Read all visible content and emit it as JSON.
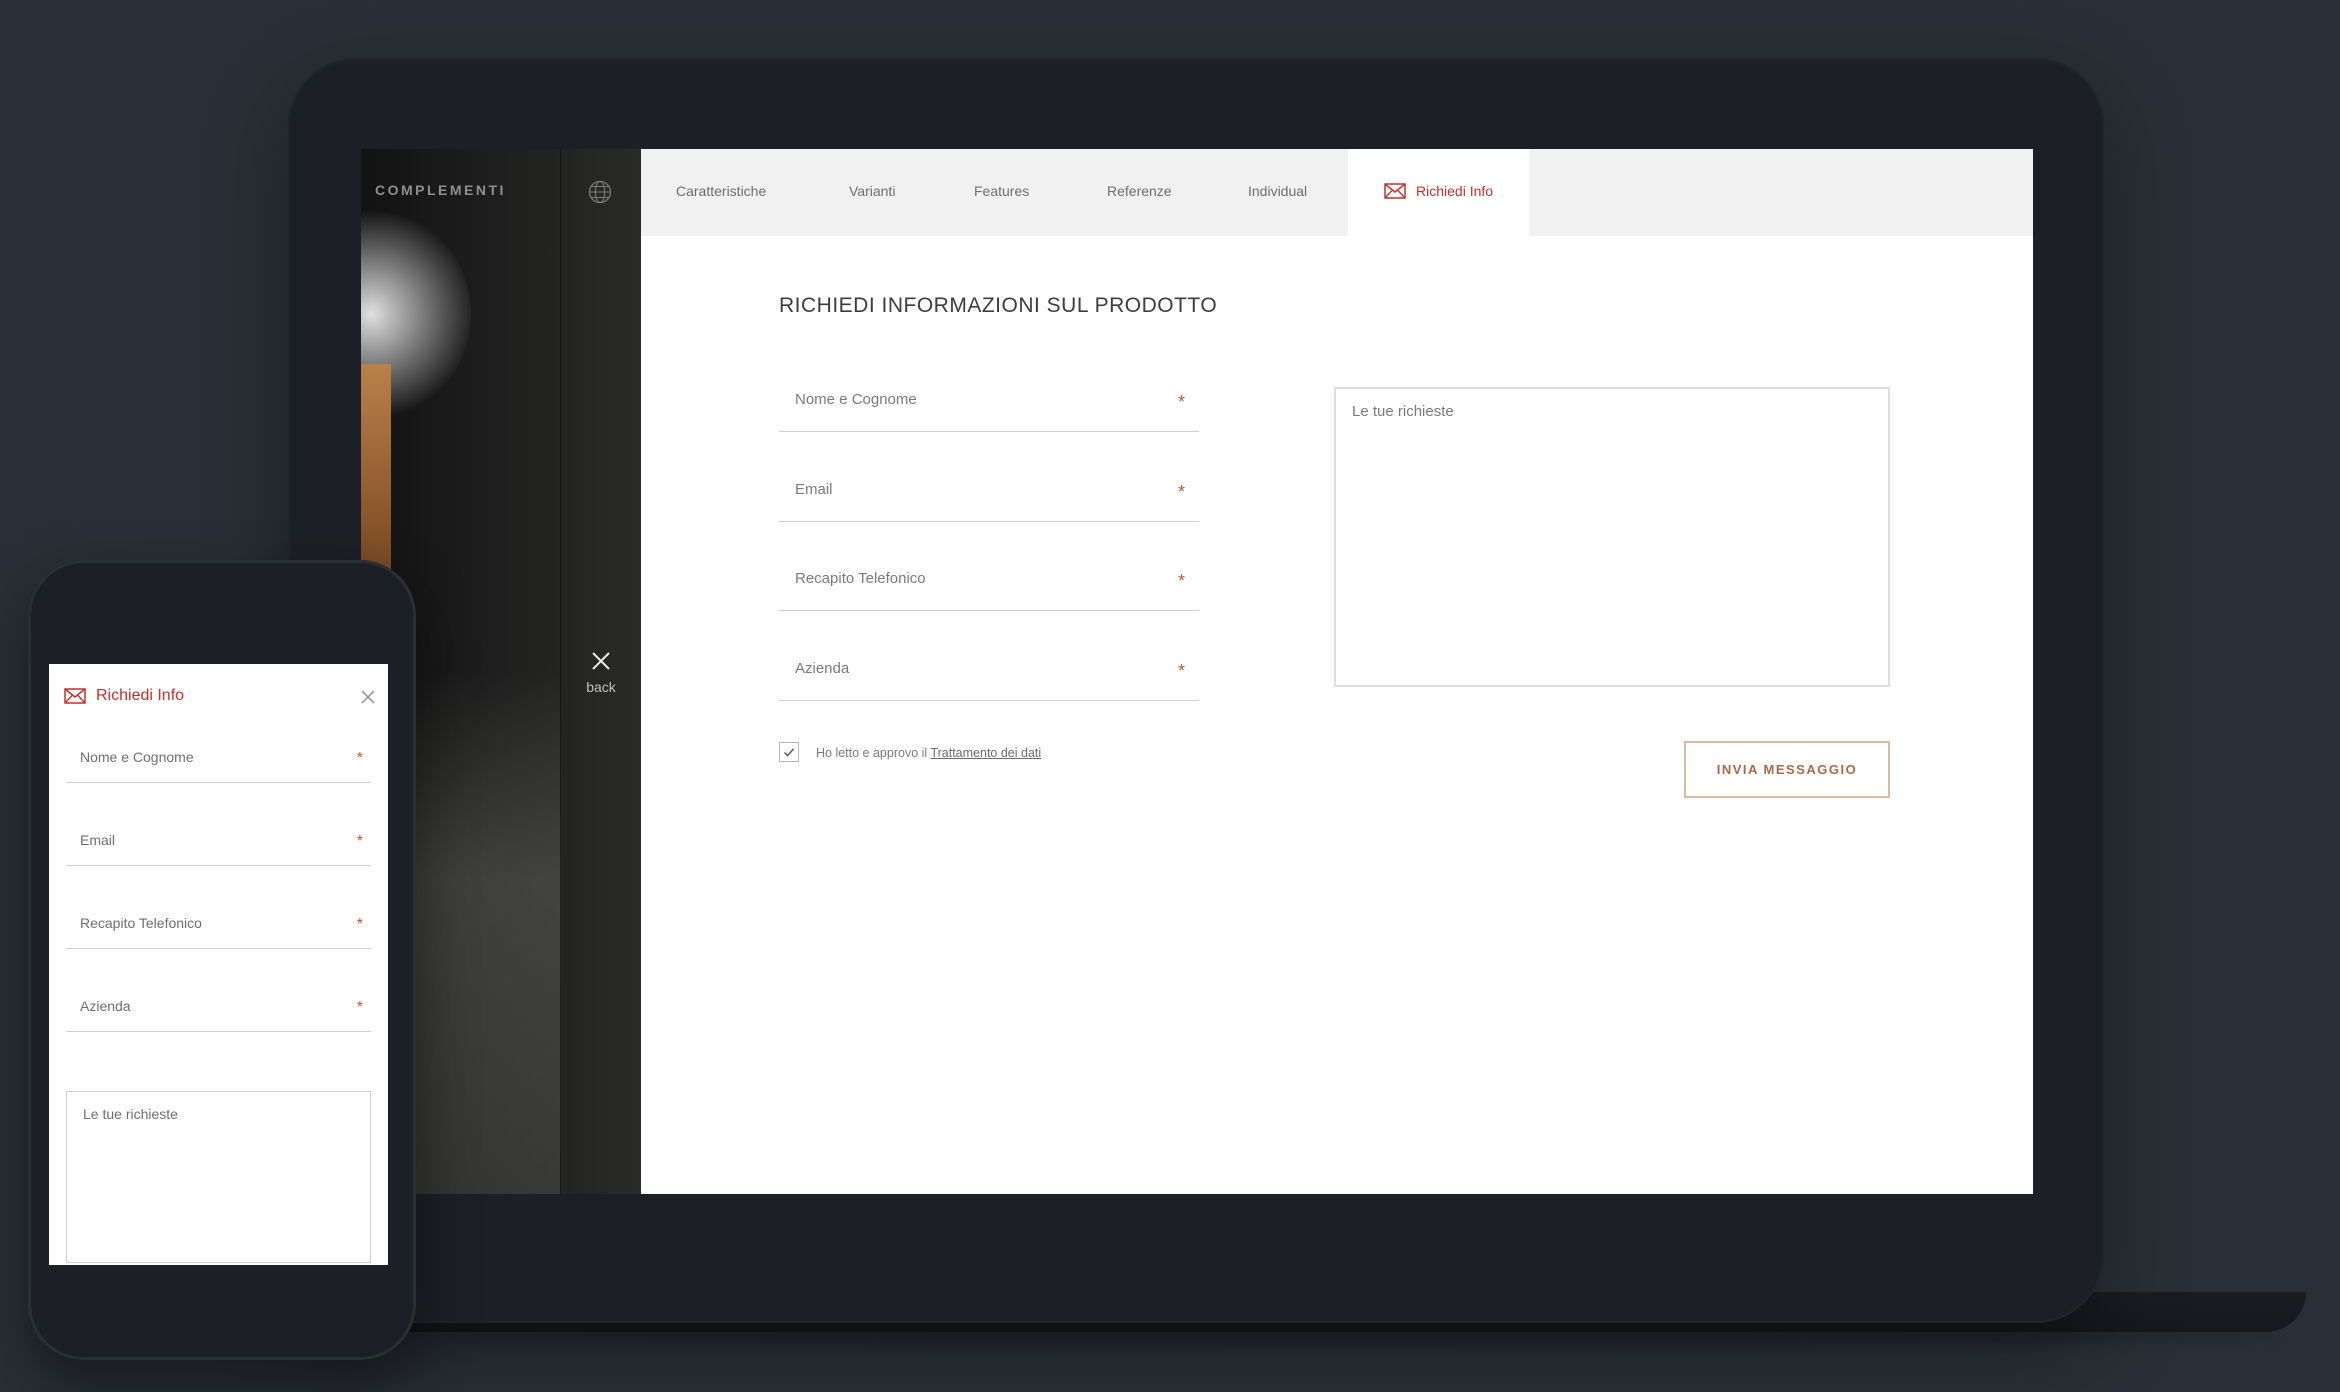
{
  "laptop": {
    "sidebar": {
      "brand": "COMPLEMENTI",
      "globe_icon": "globe-icon",
      "back_icon": "close-icon",
      "back_label": "back"
    },
    "tabs": [
      {
        "label": "Caratteristiche"
      },
      {
        "label": "Varianti"
      },
      {
        "label": "Features"
      },
      {
        "label": "Referenze"
      },
      {
        "label": "Individual"
      },
      {
        "label": "Richiedi Info",
        "icon": "mail-icon",
        "active": true
      }
    ],
    "form": {
      "title": "RICHIEDI INFORMAZIONI SUL PRODOTTO",
      "fields": [
        {
          "label": "Nome e Cognome",
          "required": "*"
        },
        {
          "label": "Email",
          "required": "*"
        },
        {
          "label": "Recapito Telefonico",
          "required": "*"
        },
        {
          "label": "Azienda",
          "required": "*"
        }
      ],
      "message_placeholder": "Le tue richieste",
      "consent_prefix": "Ho letto e approvo il",
      "consent_link": "Trattamento dei dati",
      "consent_checked": true,
      "submit_label": "INVIA MESSAGGIO"
    }
  },
  "phone": {
    "header": {
      "icon": "mail-icon",
      "title": "Richiedi Info",
      "close_icon": "close-icon"
    },
    "fields": [
      {
        "label": "Nome e Cognome",
        "required": "*"
      },
      {
        "label": "Email",
        "required": "*"
      },
      {
        "label": "Recapito Telefonico",
        "required": "*"
      },
      {
        "label": "Azienda",
        "required": "*"
      }
    ],
    "message_placeholder": "Le tue richieste"
  },
  "colors": {
    "background": "#2a2f37",
    "accent_red": "#c0312f",
    "button_border": "#d9b9a4",
    "button_text": "#a36a4c",
    "required_mark": "#b85a3a",
    "tabbar": "#f1f1f1"
  }
}
